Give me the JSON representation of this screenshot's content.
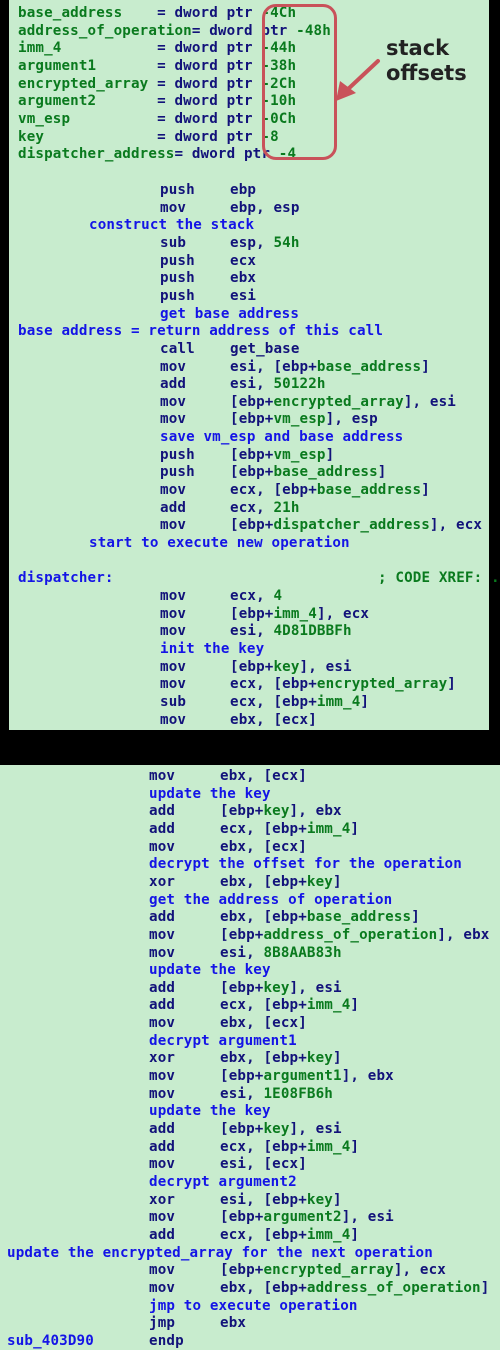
{
  "annotation": {
    "text": "stack\noffsets",
    "box_color": "#c9525a"
  },
  "colors": {
    "background": "#c8ecce",
    "variable": "#0a7a1e",
    "keyword": "#12127a",
    "comment": "#1414e6"
  },
  "panel1": {
    "declarations": [
      {
        "name": "base_address",
        "sep": "    = ",
        "type": "dword ptr",
        "offset": "-4Ch"
      },
      {
        "name": "address_of_operation",
        "sep": "= ",
        "type": "dword ptr",
        "offset": "-48h"
      },
      {
        "name": "imm_4",
        "sep": "           = ",
        "type": "dword ptr",
        "offset": "-44h"
      },
      {
        "name": "argument1",
        "sep": "       = ",
        "type": "dword ptr",
        "offset": "-38h"
      },
      {
        "name": "encrypted_array",
        "sep": " = ",
        "type": "dword ptr",
        "offset": "-2Ch"
      },
      {
        "name": "argument2",
        "sep": "       = ",
        "type": "dword ptr",
        "offset": "-10h"
      },
      {
        "name": "vm_esp",
        "sep": "          = ",
        "type": "dword ptr",
        "offset": "-0Ch"
      },
      {
        "name": "key",
        "sep": "             = ",
        "type": "dword ptr",
        "offset": "-8"
      },
      {
        "name": "dispatcher_address",
        "sep": "= ",
        "type": "dword ptr",
        "offset": "-4"
      }
    ],
    "code": [
      {
        "kind": "ins",
        "mn": "push",
        "ops": [
          [
            "kw",
            "ebp"
          ]
        ]
      },
      {
        "kind": "ins",
        "mn": "mov",
        "ops": [
          [
            "kw",
            "ebp, esp"
          ]
        ]
      },
      {
        "kind": "cmt",
        "indent": "mid",
        "text": "construct the stack"
      },
      {
        "kind": "ins",
        "mn": "sub",
        "ops": [
          [
            "kw",
            "esp, "
          ],
          [
            "var",
            "54h"
          ]
        ]
      },
      {
        "kind": "ins",
        "mn": "push",
        "ops": [
          [
            "kw",
            "ecx"
          ]
        ]
      },
      {
        "kind": "ins",
        "mn": "push",
        "ops": [
          [
            "kw",
            "ebx"
          ]
        ]
      },
      {
        "kind": "ins",
        "mn": "push",
        "ops": [
          [
            "kw",
            "esi"
          ]
        ]
      },
      {
        "kind": "cmt",
        "indent": "ins",
        "text": "get base address"
      },
      {
        "kind": "cmt",
        "indent": "left",
        "text": "base address = return address of this call"
      },
      {
        "kind": "ins",
        "mn": "call",
        "ops": [
          [
            "kw",
            "get_base"
          ]
        ]
      },
      {
        "kind": "ins",
        "mn": "mov",
        "ops": [
          [
            "kw",
            "esi, [ebp+"
          ],
          [
            "var",
            "base_address"
          ],
          [
            "kw",
            "]"
          ]
        ]
      },
      {
        "kind": "ins",
        "mn": "add",
        "ops": [
          [
            "kw",
            "esi, "
          ],
          [
            "var",
            "50122h"
          ]
        ]
      },
      {
        "kind": "ins",
        "mn": "mov",
        "ops": [
          [
            "kw",
            "[ebp+"
          ],
          [
            "var",
            "encrypted_array"
          ],
          [
            "kw",
            "], esi"
          ]
        ]
      },
      {
        "kind": "ins",
        "mn": "mov",
        "ops": [
          [
            "kw",
            "[ebp+"
          ],
          [
            "var",
            "vm_esp"
          ],
          [
            "kw",
            "], esp"
          ]
        ]
      },
      {
        "kind": "cmt",
        "indent": "ins",
        "text": "save vm_esp and base address"
      },
      {
        "kind": "ins",
        "mn": "push",
        "ops": [
          [
            "kw",
            "[ebp+"
          ],
          [
            "var",
            "vm_esp"
          ],
          [
            "kw",
            "]"
          ]
        ]
      },
      {
        "kind": "ins",
        "mn": "push",
        "ops": [
          [
            "kw",
            "[ebp+"
          ],
          [
            "var",
            "base_address"
          ],
          [
            "kw",
            "]"
          ]
        ]
      },
      {
        "kind": "ins",
        "mn": "mov",
        "ops": [
          [
            "kw",
            "ecx, [ebp+"
          ],
          [
            "var",
            "base_address"
          ],
          [
            "kw",
            "]"
          ]
        ]
      },
      {
        "kind": "ins",
        "mn": "add",
        "ops": [
          [
            "kw",
            "ecx, "
          ],
          [
            "var",
            "21h"
          ]
        ]
      },
      {
        "kind": "ins",
        "mn": "mov",
        "ops": [
          [
            "kw",
            "[ebp+"
          ],
          [
            "var",
            "dispatcher_address"
          ],
          [
            "kw",
            "], ecx"
          ]
        ]
      },
      {
        "kind": "cmt",
        "indent": "mid",
        "text": "start to execute new operation"
      },
      {
        "kind": "blank"
      },
      {
        "kind": "label",
        "text": "dispatcher:",
        "xref": "; CODE XREF: ."
      },
      {
        "kind": "ins",
        "mn": "mov",
        "ops": [
          [
            "kw",
            "ecx, "
          ],
          [
            "var",
            "4"
          ]
        ]
      },
      {
        "kind": "ins",
        "mn": "mov",
        "ops": [
          [
            "kw",
            "[ebp+"
          ],
          [
            "var",
            "imm_4"
          ],
          [
            "kw",
            "], ecx"
          ]
        ]
      },
      {
        "kind": "ins",
        "mn": "mov",
        "ops": [
          [
            "kw",
            "esi, "
          ],
          [
            "var",
            "4D81DBBFh"
          ]
        ]
      },
      {
        "kind": "cmt",
        "indent": "ins",
        "text": "init the key"
      },
      {
        "kind": "ins",
        "mn": "mov",
        "ops": [
          [
            "kw",
            "[ebp+"
          ],
          [
            "var",
            "key"
          ],
          [
            "kw",
            "], esi"
          ]
        ]
      },
      {
        "kind": "ins",
        "mn": "mov",
        "ops": [
          [
            "kw",
            "ecx, [ebp+"
          ],
          [
            "var",
            "encrypted_array"
          ],
          [
            "kw",
            "]"
          ]
        ]
      },
      {
        "kind": "ins",
        "mn": "sub",
        "ops": [
          [
            "kw",
            "ecx, [ebp+"
          ],
          [
            "var",
            "imm_4"
          ],
          [
            "kw",
            "]"
          ]
        ]
      },
      {
        "kind": "ins",
        "mn": "mov",
        "ops": [
          [
            "kw",
            "ebx, [ecx]"
          ]
        ]
      }
    ]
  },
  "panel2": {
    "code": [
      {
        "kind": "ins",
        "mn": "mov",
        "ops": [
          [
            "kw",
            "ebx, [ecx]"
          ]
        ]
      },
      {
        "kind": "cmt",
        "indent": "ins",
        "text": "update the key"
      },
      {
        "kind": "ins",
        "mn": "add",
        "ops": [
          [
            "kw",
            "[ebp+"
          ],
          [
            "var",
            "key"
          ],
          [
            "kw",
            "], ebx"
          ]
        ]
      },
      {
        "kind": "ins",
        "mn": "add",
        "ops": [
          [
            "kw",
            "ecx, [ebp+"
          ],
          [
            "var",
            "imm_4"
          ],
          [
            "kw",
            "]"
          ]
        ]
      },
      {
        "kind": "ins",
        "mn": "mov",
        "ops": [
          [
            "kw",
            "ebx, [ecx]"
          ]
        ]
      },
      {
        "kind": "cmt",
        "indent": "ins",
        "text": "decrypt the offset for the operation"
      },
      {
        "kind": "ins",
        "mn": "xor",
        "ops": [
          [
            "kw",
            "ebx, [ebp+"
          ],
          [
            "var",
            "key"
          ],
          [
            "kw",
            "]"
          ]
        ]
      },
      {
        "kind": "cmt",
        "indent": "ins",
        "text": "get the address of operation"
      },
      {
        "kind": "ins",
        "mn": "add",
        "ops": [
          [
            "kw",
            "ebx, [ebp+"
          ],
          [
            "var",
            "base_address"
          ],
          [
            "kw",
            "]"
          ]
        ]
      },
      {
        "kind": "ins",
        "mn": "mov",
        "ops": [
          [
            "kw",
            "[ebp+"
          ],
          [
            "var",
            "address_of_operation"
          ],
          [
            "kw",
            "], ebx"
          ]
        ]
      },
      {
        "kind": "ins",
        "mn": "mov",
        "ops": [
          [
            "kw",
            "esi, "
          ],
          [
            "var",
            "8B8AAB83h"
          ]
        ]
      },
      {
        "kind": "cmt",
        "indent": "ins",
        "text": "update the key"
      },
      {
        "kind": "ins",
        "mn": "add",
        "ops": [
          [
            "kw",
            "[ebp+"
          ],
          [
            "var",
            "key"
          ],
          [
            "kw",
            "], esi"
          ]
        ]
      },
      {
        "kind": "ins",
        "mn": "add",
        "ops": [
          [
            "kw",
            "ecx, [ebp+"
          ],
          [
            "var",
            "imm_4"
          ],
          [
            "kw",
            "]"
          ]
        ]
      },
      {
        "kind": "ins",
        "mn": "mov",
        "ops": [
          [
            "kw",
            "ebx, [ecx]"
          ]
        ]
      },
      {
        "kind": "cmt",
        "indent": "ins",
        "text": "decrypt argument1"
      },
      {
        "kind": "ins",
        "mn": "xor",
        "ops": [
          [
            "kw",
            "ebx, [ebp+"
          ],
          [
            "var",
            "key"
          ],
          [
            "kw",
            "]"
          ]
        ]
      },
      {
        "kind": "ins",
        "mn": "mov",
        "ops": [
          [
            "kw",
            "[ebp+"
          ],
          [
            "var",
            "argument1"
          ],
          [
            "kw",
            "], ebx"
          ]
        ]
      },
      {
        "kind": "ins",
        "mn": "mov",
        "ops": [
          [
            "kw",
            "esi, "
          ],
          [
            "var",
            "1E08FB6h"
          ]
        ]
      },
      {
        "kind": "cmt",
        "indent": "ins",
        "text": "update the key"
      },
      {
        "kind": "ins",
        "mn": "add",
        "ops": [
          [
            "kw",
            "[ebp+"
          ],
          [
            "var",
            "key"
          ],
          [
            "kw",
            "], esi"
          ]
        ]
      },
      {
        "kind": "ins",
        "mn": "add",
        "ops": [
          [
            "kw",
            "ecx, [ebp+"
          ],
          [
            "var",
            "imm_4"
          ],
          [
            "kw",
            "]"
          ]
        ]
      },
      {
        "kind": "ins",
        "mn": "mov",
        "ops": [
          [
            "kw",
            "esi, [ecx]"
          ]
        ]
      },
      {
        "kind": "cmt",
        "indent": "ins",
        "text": "decrypt argument2"
      },
      {
        "kind": "ins",
        "mn": "xor",
        "ops": [
          [
            "kw",
            "esi, [ebp+"
          ],
          [
            "var",
            "key"
          ],
          [
            "kw",
            "]"
          ]
        ]
      },
      {
        "kind": "ins",
        "mn": "mov",
        "ops": [
          [
            "kw",
            "[ebp+"
          ],
          [
            "var",
            "argument2"
          ],
          [
            "kw",
            "], esi"
          ]
        ]
      },
      {
        "kind": "ins",
        "mn": "add",
        "ops": [
          [
            "kw",
            "ecx, [ebp+"
          ],
          [
            "var",
            "imm_4"
          ],
          [
            "kw",
            "]"
          ]
        ]
      },
      {
        "kind": "cmt",
        "indent": "left",
        "text": "update the encrypted_array for the next operation"
      },
      {
        "kind": "ins",
        "mn": "mov",
        "ops": [
          [
            "kw",
            "[ebp+"
          ],
          [
            "var",
            "encrypted_array"
          ],
          [
            "kw",
            "], ecx"
          ]
        ]
      },
      {
        "kind": "ins",
        "mn": "mov",
        "ops": [
          [
            "kw",
            "ebx, [ebp+"
          ],
          [
            "var",
            "address_of_operation"
          ],
          [
            "kw",
            "]"
          ]
        ]
      },
      {
        "kind": "cmt",
        "indent": "ins",
        "text": "jmp to execute operation"
      },
      {
        "kind": "ins",
        "mn": "jmp",
        "ops": [
          [
            "kw",
            "ebx"
          ]
        ]
      },
      {
        "kind": "endp",
        "label": "sub_403D90",
        "mn": "endp"
      }
    ]
  }
}
